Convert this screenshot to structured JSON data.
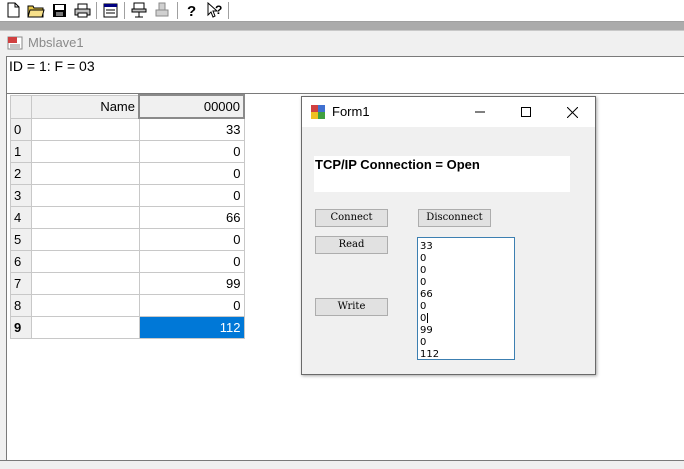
{
  "toolbar": {
    "icons": [
      "new-file-icon",
      "open-folder-icon",
      "save-icon",
      "print-icon",
      "window-icon",
      "connect-icon",
      "disconnect-icon",
      "help-icon",
      "context-help-icon"
    ]
  },
  "child_window": {
    "title": "Mbslave1",
    "id_line": "ID = 1: F = 03"
  },
  "grid": {
    "header_name": "Name",
    "header_value": "00000",
    "rows": [
      {
        "index": "0",
        "name": "",
        "value": "33"
      },
      {
        "index": "1",
        "name": "",
        "value": "0"
      },
      {
        "index": "2",
        "name": "",
        "value": "0"
      },
      {
        "index": "3",
        "name": "",
        "value": "0"
      },
      {
        "index": "4",
        "name": "",
        "value": "66"
      },
      {
        "index": "5",
        "name": "",
        "value": "0"
      },
      {
        "index": "6",
        "name": "",
        "value": "0"
      },
      {
        "index": "7",
        "name": "",
        "value": "99"
      },
      {
        "index": "8",
        "name": "",
        "value": "0"
      },
      {
        "index": "9",
        "name": "",
        "value": "112"
      }
    ],
    "selected_row": "9"
  },
  "form1": {
    "title": "Form1",
    "status": "TCP/IP Connection = Open",
    "buttons": {
      "connect": "Connect",
      "disconnect": "Disconnect",
      "read": "Read",
      "write": "Write"
    },
    "list_values": [
      "33",
      "0",
      "0",
      "0",
      "66",
      "0",
      "0",
      "99",
      "0",
      "112"
    ]
  },
  "colors": {
    "selection": "#0078d7",
    "listbox_border": "#3c7fb1"
  }
}
